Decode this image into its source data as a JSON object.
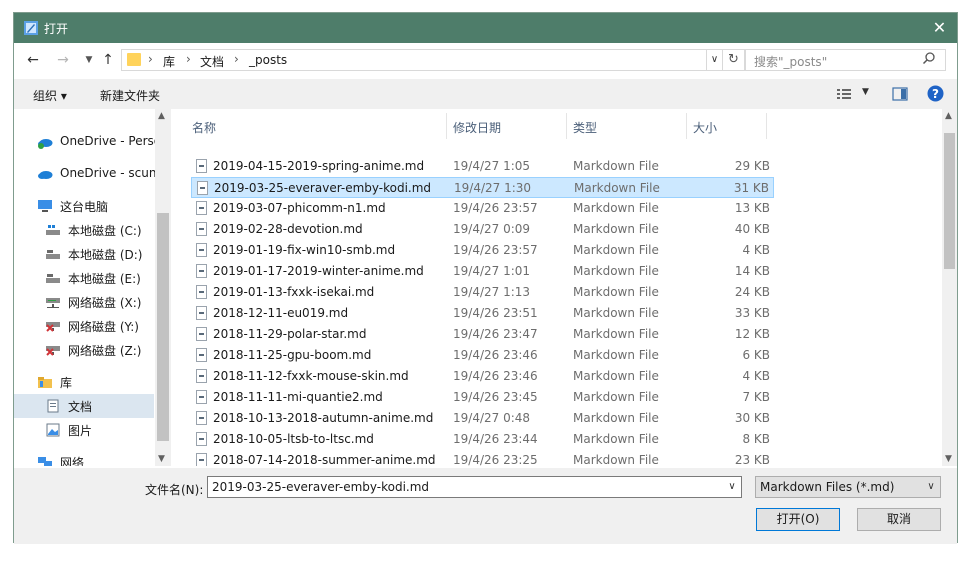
{
  "window": {
    "title": "打开"
  },
  "address": {
    "crumbs": [
      "库",
      "文档",
      "_posts"
    ],
    "search_placeholder": "搜索\"_posts\""
  },
  "toolbar": {
    "organize": "组织 ▾",
    "new_folder": "新建文件夹"
  },
  "nav": {
    "items": [
      {
        "label": "OneDrive - Perso",
        "icon": "onedrive-icon"
      },
      {
        "label": "OneDrive - scun",
        "icon": "onedrive-icon"
      },
      {
        "label": "这台电脑",
        "icon": "computer-icon"
      },
      {
        "label": "本地磁盘 (C:)",
        "icon": "drive-icon"
      },
      {
        "label": "本地磁盘 (D:)",
        "icon": "drive-icon"
      },
      {
        "label": "本地磁盘 (E:)",
        "icon": "drive-icon"
      },
      {
        "label": "网络磁盘 (X:)",
        "icon": "network-drive-icon"
      },
      {
        "label": "网络磁盘 (Y:)",
        "icon": "network-drive-disconnected-icon"
      },
      {
        "label": "网络磁盘 (Z:)",
        "icon": "network-drive-disconnected-icon"
      },
      {
        "label": "库",
        "icon": "library-icon"
      },
      {
        "label": "文档",
        "icon": "documents-icon"
      },
      {
        "label": "图片",
        "icon": "pictures-icon"
      },
      {
        "label": "网络",
        "icon": "network-icon"
      }
    ]
  },
  "columns": {
    "name": "名称",
    "date": "修改日期",
    "type": "类型",
    "size": "大小"
  },
  "files": [
    {
      "name": "2019-04-15-2019-spring-anime.md",
      "date": "19/4/27 1:05",
      "type": "Markdown File",
      "size": "29 KB"
    },
    {
      "name": "2019-03-25-everaver-emby-kodi.md",
      "date": "19/4/27 1:30",
      "type": "Markdown File",
      "size": "31 KB"
    },
    {
      "name": "2019-03-07-phicomm-n1.md",
      "date": "19/4/26 23:57",
      "type": "Markdown File",
      "size": "13 KB"
    },
    {
      "name": "2019-02-28-devotion.md",
      "date": "19/4/27 0:09",
      "type": "Markdown File",
      "size": "40 KB"
    },
    {
      "name": "2019-01-19-fix-win10-smb.md",
      "date": "19/4/26 23:57",
      "type": "Markdown File",
      "size": "4 KB"
    },
    {
      "name": "2019-01-17-2019-winter-anime.md",
      "date": "19/4/27 1:01",
      "type": "Markdown File",
      "size": "14 KB"
    },
    {
      "name": "2019-01-13-fxxk-isekai.md",
      "date": "19/4/27 1:13",
      "type": "Markdown File",
      "size": "24 KB"
    },
    {
      "name": "2018-12-11-eu019.md",
      "date": "19/4/26 23:51",
      "type": "Markdown File",
      "size": "33 KB"
    },
    {
      "name": "2018-11-29-polar-star.md",
      "date": "19/4/26 23:47",
      "type": "Markdown File",
      "size": "12 KB"
    },
    {
      "name": "2018-11-25-gpu-boom.md",
      "date": "19/4/26 23:46",
      "type": "Markdown File",
      "size": "6 KB"
    },
    {
      "name": "2018-11-12-fxxk-mouse-skin.md",
      "date": "19/4/26 23:46",
      "type": "Markdown File",
      "size": "4 KB"
    },
    {
      "name": "2018-11-11-mi-quantie2.md",
      "date": "19/4/26 23:45",
      "type": "Markdown File",
      "size": "7 KB"
    },
    {
      "name": "2018-10-13-2018-autumn-anime.md",
      "date": "19/4/27 0:48",
      "type": "Markdown File",
      "size": "30 KB"
    },
    {
      "name": "2018-10-05-ltsb-to-ltsc.md",
      "date": "19/4/26 23:44",
      "type": "Markdown File",
      "size": "8 KB"
    },
    {
      "name": "2018-07-14-2018-summer-anime.md",
      "date": "19/4/26 23:25",
      "type": "Markdown File",
      "size": "23 KB"
    }
  ],
  "selected_index": 1,
  "bottom": {
    "filename_label": "文件名(N):",
    "filename_value": "2019-03-25-everaver-emby-kodi.md",
    "filter": "Markdown Files (*.md)",
    "open": "打开(O)",
    "cancel": "取消"
  },
  "colors": {
    "titlebar": "#4e7d6a",
    "selection": "#cce8ff",
    "accent": "#0078d7"
  }
}
